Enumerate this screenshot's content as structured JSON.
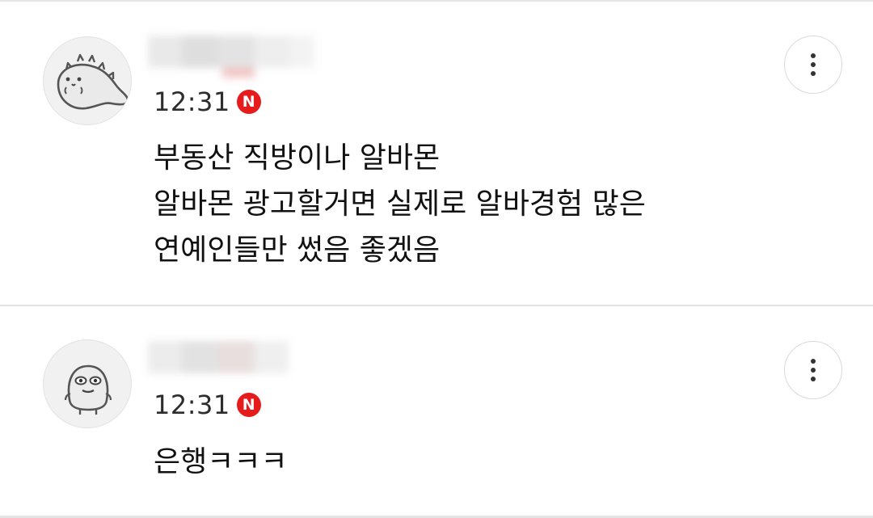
{
  "comments": [
    {
      "author": "",
      "author_redacted": true,
      "time": "12:31",
      "badge": "N",
      "badge_color": "#e61c1c",
      "avatar_icon": "dinosaur-avatar-icon",
      "text": "부동산 직방이나 알바몬\n알바몬 광고할거면 실제로 알바경험 많은\n연예인들만 썼음 좋겠음"
    },
    {
      "author": "",
      "author_redacted": true,
      "time": "12:31",
      "badge": "N",
      "badge_color": "#e61c1c",
      "avatar_icon": "blob-character-avatar-icon",
      "text": "은행ㅋㅋㅋ"
    }
  ],
  "colors": {
    "background": "#ffffff",
    "divider": "#e3e3e3",
    "text": "#111111",
    "time": "#2d2d2d"
  }
}
